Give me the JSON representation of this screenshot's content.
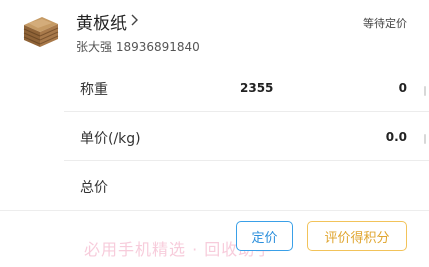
{
  "header": {
    "title": "黄板纸",
    "subtitle": "张大强 18936891840",
    "status": "等待定价",
    "thumbnail": "cardboard-stack-image"
  },
  "rows": [
    {
      "label": "称重",
      "middle": "2355",
      "value": "0"
    },
    {
      "label": "单价(/kg)",
      "middle": "",
      "value": "0.0"
    },
    {
      "label": "总价",
      "middle": "",
      "value": ""
    }
  ],
  "footer": {
    "watermark": "必用手机精选 · 回收助手",
    "price_button": "定价",
    "rate_button": "评价得积分"
  },
  "colors": {
    "price_button": "#2b8fdc",
    "rate_button": "#e0a630",
    "watermark": "#f7c7d8"
  }
}
